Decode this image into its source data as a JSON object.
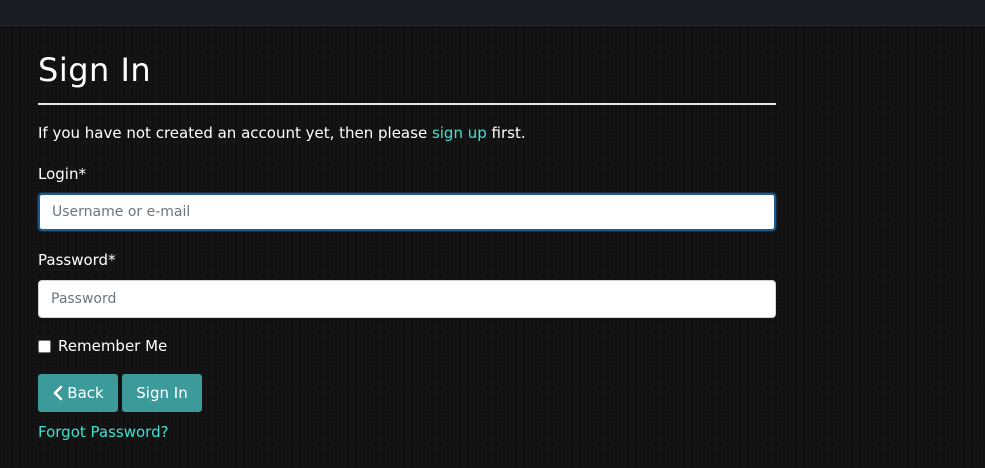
{
  "page": {
    "title": "Sign In"
  },
  "intro": {
    "before": "If you have not created an account yet, then please ",
    "link": "sign up",
    "after": " first."
  },
  "form": {
    "login_label": "Login*",
    "login_placeholder": "Username or e-mail",
    "login_value": "",
    "password_label": "Password*",
    "password_placeholder": "Password",
    "password_value": "",
    "remember_label": "Remember Me",
    "remember_checked": false
  },
  "buttons": {
    "back_label": "Back",
    "back_icon": "chevron-left-icon",
    "signin_label": "Sign In"
  },
  "links": {
    "forgot_password": "Forgot Password?"
  },
  "colors": {
    "accent_link": "#40e0d0",
    "button_bg": "#3d9a9b",
    "background": "#121212"
  }
}
